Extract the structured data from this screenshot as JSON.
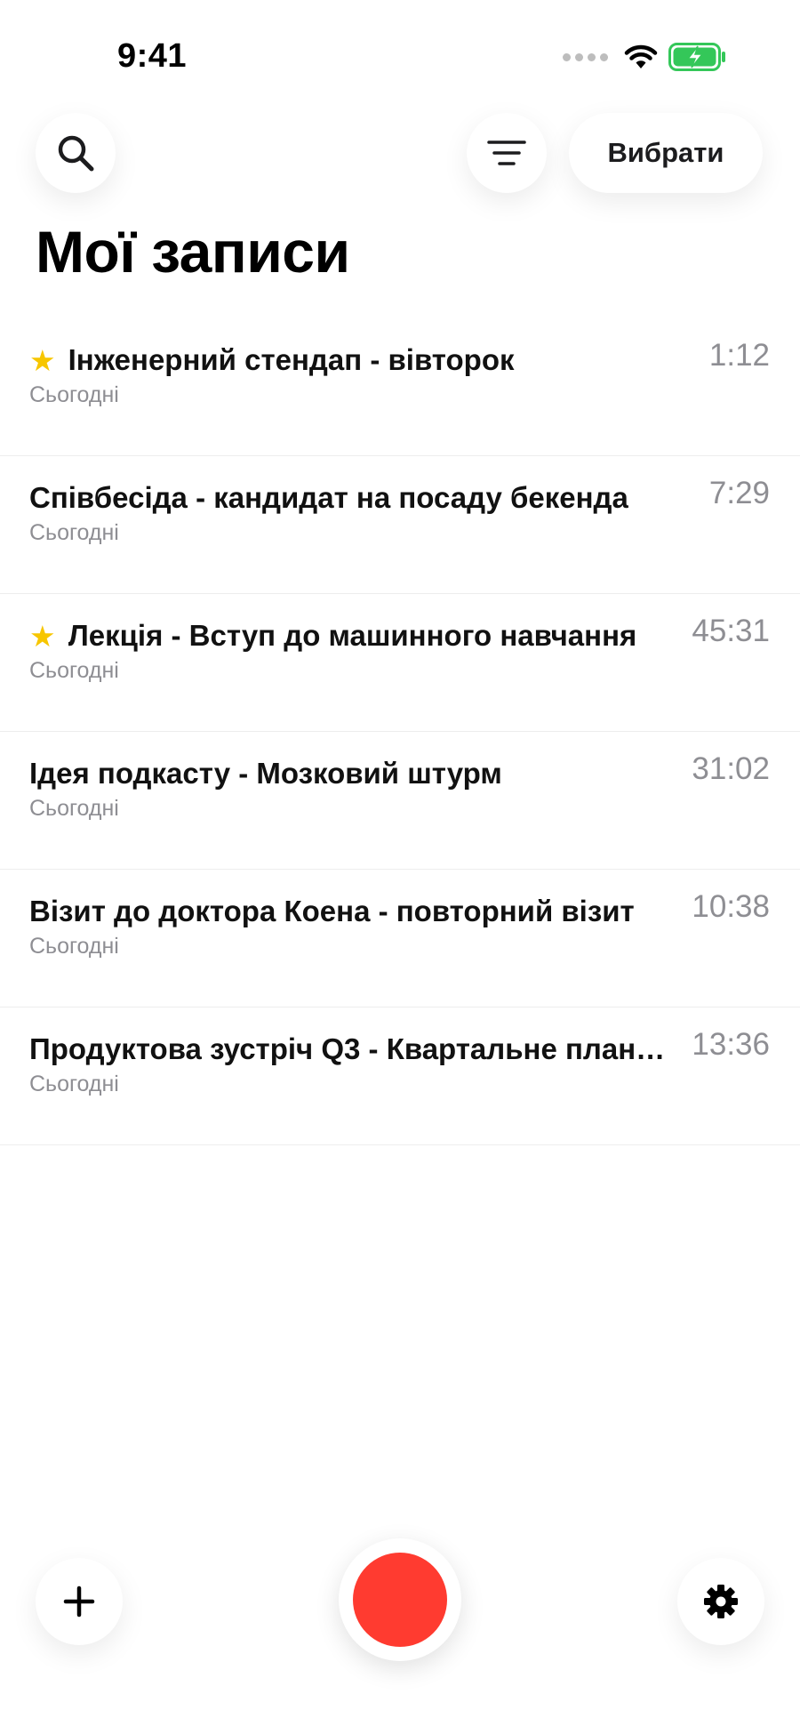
{
  "status_bar": {
    "time": "9:41",
    "icons": [
      "signal-icon",
      "wifi-icon",
      "battery-charging-icon"
    ]
  },
  "header": {
    "search_icon": "search-icon",
    "filter_icon": "filter-icon",
    "select_label": "Вибрати",
    "title": "Мої записи"
  },
  "recordings": [
    {
      "title": "Інженерний стендап - вівторок",
      "date": "Сьогодні",
      "duration": "1:12",
      "starred": true
    },
    {
      "title": "Співбесіда - кандидат на посаду бекенда",
      "date": "Сьогодні",
      "duration": "7:29",
      "starred": false
    },
    {
      "title": "Лекція - Вступ до машинного навчання",
      "date": "Сьогодні",
      "duration": "45:31",
      "starred": true
    },
    {
      "title": "Ідея подкасту - Мозковий штурм",
      "date": "Сьогодні",
      "duration": "31:02",
      "starred": false
    },
    {
      "title": "Візит до доктора Коена - повторний візит",
      "date": "Сьогодні",
      "duration": "10:38",
      "starred": false
    },
    {
      "title": "Продуктова зустріч Q3 - Квартальне плану...",
      "date": "Сьогодні",
      "duration": "13:36",
      "starred": false
    }
  ],
  "bottom_bar": {
    "add_icon": "plus-icon",
    "record_icon": "record-icon",
    "settings_icon": "gear-icon"
  },
  "colors": {
    "accent_record": "#ff3b30",
    "star": "#f7c600",
    "battery": "#34c759",
    "secondary_text": "#8e8e93"
  }
}
